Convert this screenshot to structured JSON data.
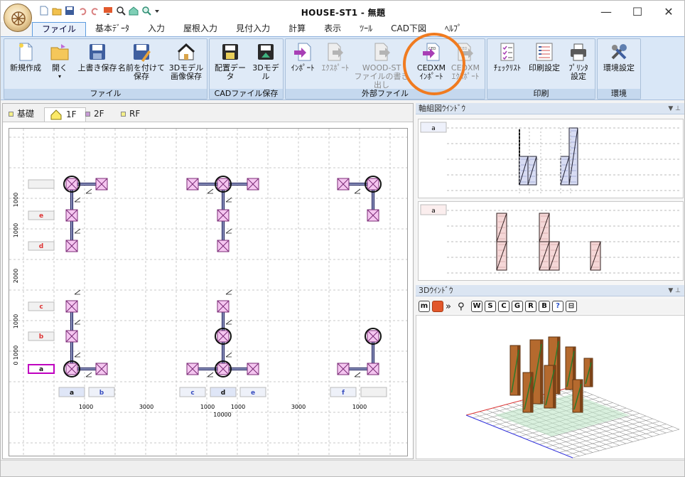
{
  "window": {
    "title": "HOUSE-ST1 - 無題",
    "controls": {
      "minimize": "—",
      "maximize": "☐",
      "close": "✕"
    }
  },
  "menu_tabs": [
    {
      "label": "ファイル",
      "active": true
    },
    {
      "label": "基本ﾃﾞｰﾀ"
    },
    {
      "label": "入力"
    },
    {
      "label": "屋根入力"
    },
    {
      "label": "見付入力"
    },
    {
      "label": "計算"
    },
    {
      "label": "表示"
    },
    {
      "label": "ﾂｰﾙ"
    },
    {
      "label": "CAD下図"
    },
    {
      "label": "ﾍﾙﾌﾟ"
    }
  ],
  "ribbon": {
    "groups": {
      "file": "ファイル",
      "cad": "CADファイル保存",
      "external": "外部ファイル",
      "print": "印刷",
      "env": "環境"
    },
    "buttons": {
      "new": [
        "新規作成"
      ],
      "open": [
        "開く"
      ],
      "save": [
        "上書き保存"
      ],
      "saveas": [
        "名前を付けて",
        "保存"
      ],
      "img3d": [
        "3Dモデル",
        "画像保存"
      ],
      "layout": [
        "配置データ"
      ],
      "model3d": [
        "3Dモデル"
      ],
      "import": [
        "ｲﾝﾎﾟｰﾄ"
      ],
      "export": [
        "ｴｸｽﾎﾟｰﾄ"
      ],
      "woodst": [
        "WOOD-ST",
        "ファイルの書き出し"
      ],
      "cedxm_import": [
        "CEDXM",
        "ｲﾝﾎﾟｰﾄ"
      ],
      "cedxm_export": [
        "CEDXM",
        "ｴｸｽﾎﾟｰﾄ"
      ],
      "checklist": [
        "ﾁｪｯｸﾘｽﾄ"
      ],
      "printset": [
        "印刷設定"
      ],
      "printer": [
        "ﾌﾟﾘﾝﾀ",
        "設定"
      ],
      "envset": [
        "環境設定"
      ]
    }
  },
  "floor_tabs": [
    "基礎",
    "1F",
    "2F",
    "RF"
  ],
  "active_floor": "1F",
  "plan": {
    "row_labels": [
      "a",
      "b",
      "c",
      "d",
      "e"
    ],
    "col_labels": [
      "a",
      "b",
      "c",
      "d",
      "e",
      "f"
    ],
    "left_dims": [
      "1000",
      "1000",
      "2000",
      "1000",
      "1000",
      "0"
    ],
    "bottom_dims": [
      "1000",
      "3000",
      "1000",
      "1000",
      "3000",
      "1000"
    ],
    "total_dim": "10000"
  },
  "panes": {
    "axis_title": "軸組図ｳｲﾝﾄﾞｳ",
    "axis_top_label": "a",
    "axis_bottom_label": "a",
    "view3d_title": "3Dｳｲﾝﾄﾞｳ",
    "toolbar3d": [
      "W",
      "S",
      "C",
      "G",
      "R",
      "B"
    ]
  },
  "colors": {
    "accent": "#5d9cdf",
    "highlight": "#f07b20",
    "column_fill": "#f5c6f0",
    "brace": "#1b1b5a"
  }
}
